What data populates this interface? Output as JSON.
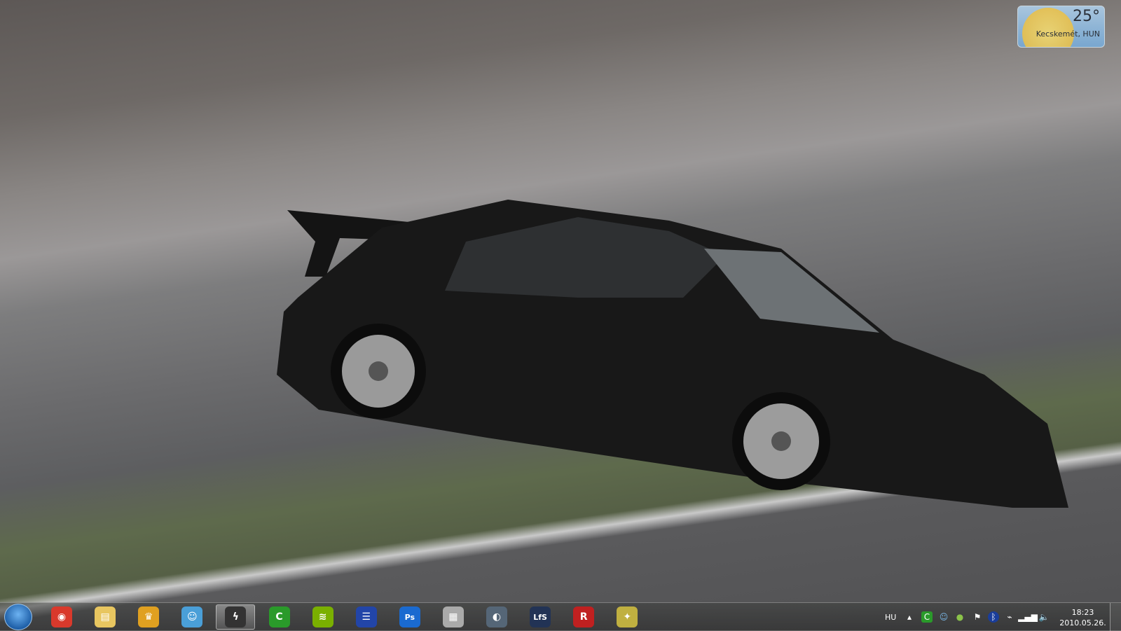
{
  "weather": {
    "temperature": "25°",
    "location": "Kecskemét, HUN"
  },
  "taskbar": {
    "pinned": [
      {
        "name": "chrome",
        "glyph": "◉",
        "color": "#d9392c"
      },
      {
        "name": "windows-explorer",
        "glyph": "▤",
        "color": "#e8c660"
      },
      {
        "name": "miranda",
        "glyph": "♛",
        "color": "#e0a020"
      },
      {
        "name": "windows-live-messenger",
        "glyph": "☺",
        "color": "#4a9fd8"
      },
      {
        "name": "winamp",
        "glyph": "ϟ",
        "color": "#333333"
      },
      {
        "name": "bittorrent",
        "glyph": "C",
        "color": "#2a9a2a"
      },
      {
        "name": "spotify",
        "glyph": "≋",
        "color": "#7ab000"
      },
      {
        "name": "save-app",
        "glyph": "☰",
        "color": "#2245a8"
      },
      {
        "name": "photoshop",
        "glyph": "Ps",
        "color": "#1a6ad0"
      },
      {
        "name": "movie-maker",
        "glyph": "▦",
        "color": "#aaaaaa"
      },
      {
        "name": "teamspeak",
        "glyph": "◐",
        "color": "#556677"
      },
      {
        "name": "live-for-speed",
        "glyph": "LfS",
        "color": "#223355"
      },
      {
        "name": "rockstar-app",
        "glyph": "R",
        "color": "#c02020"
      },
      {
        "name": "counter-strike",
        "glyph": "✦",
        "color": "#c0b040"
      }
    ],
    "active_index": 4,
    "tray": {
      "language": "HU",
      "time": "18:23",
      "date": "2010.05.26."
    }
  }
}
